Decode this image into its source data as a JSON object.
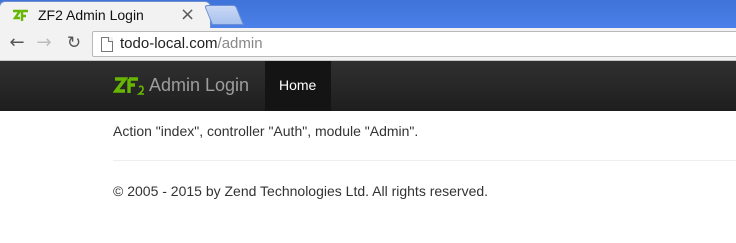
{
  "browser": {
    "tab_title": "ZF2 Admin Login",
    "tab_close_icon": "close-icon",
    "url_host": "todo-local.com",
    "url_path": "/admin"
  },
  "navbar": {
    "brand_text": "Admin Login",
    "brand_icon": "zf2-logo-icon",
    "home_label": "Home"
  },
  "content": {
    "message": "Action \"index\", controller \"Auth\", module \"Admin\"."
  },
  "footer": {
    "copyright": "© 2005 - 2015 by Zend Technologies Ltd. All rights reserved."
  },
  "colors": {
    "navbar_bg": "#222222",
    "zf_green": "#68b604",
    "tabstrip_blue": "#4a80e8"
  }
}
